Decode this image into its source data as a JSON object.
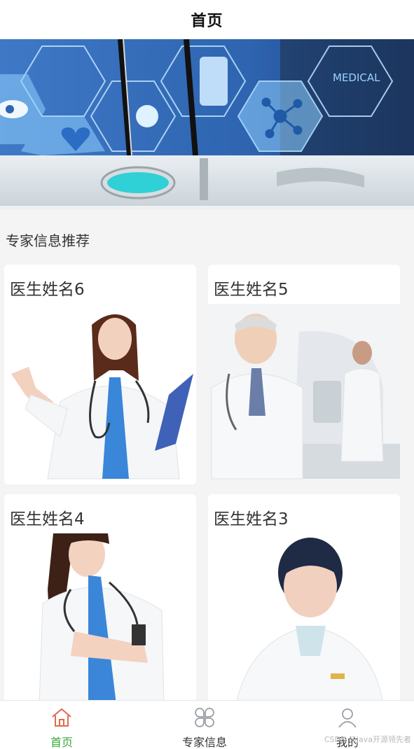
{
  "header": {
    "title": "首页"
  },
  "banner": {
    "medical_text": "MEDICAL"
  },
  "section": {
    "title": "专家信息推荐"
  },
  "cards": [
    {
      "name": "医生姓名6"
    },
    {
      "name": "医生姓名5"
    },
    {
      "name": "医生姓名4"
    },
    {
      "name": "医生姓名3"
    }
  ],
  "tabbar": {
    "home": "首页",
    "experts": "专家信息",
    "mine": "我的"
  },
  "watermark": "CSDN @Java开源领先者",
  "colors": {
    "active": "#3aa83a",
    "active_icon": "#e06a4f",
    "banner_blue": "#2f6fc0"
  }
}
